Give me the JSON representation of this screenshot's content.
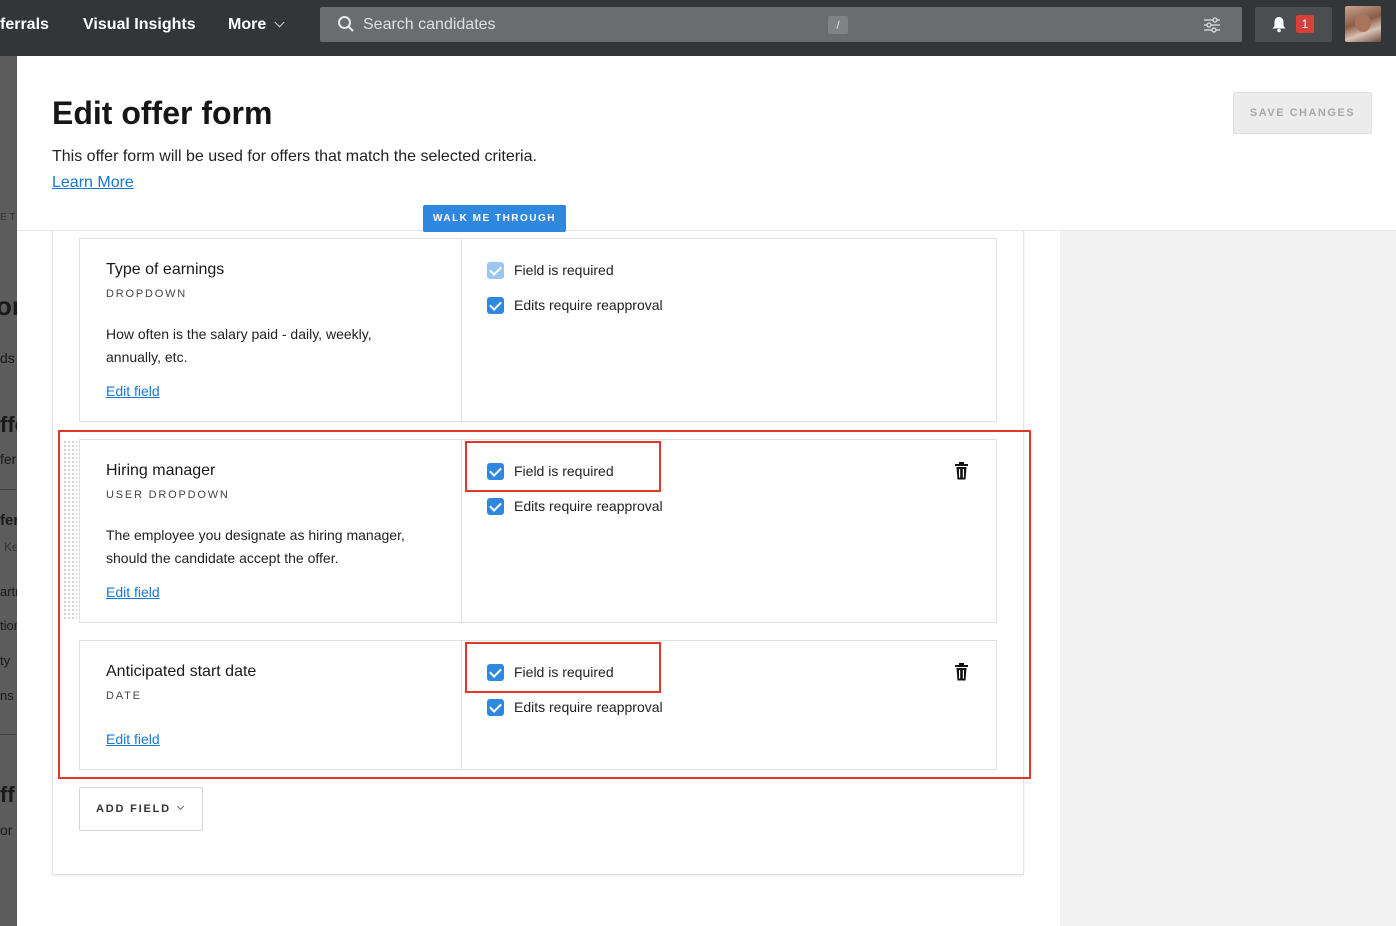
{
  "nav": {
    "items": [
      {
        "label": "ferrals"
      },
      {
        "label": "Visual Insights"
      },
      {
        "label": "More"
      }
    ],
    "search": {
      "placeholder": "Search candidates",
      "shortcut": "/"
    },
    "notifications_count": "1"
  },
  "background_page": {
    "fragments": [
      "E T",
      "or",
      "ds",
      "ffe",
      "fer",
      "fer",
      "Ke",
      "artr",
      "tion",
      "ty",
      "ns",
      "ff",
      "or"
    ]
  },
  "modal": {
    "title": "Edit offer form",
    "subtitle": "This offer form will be used for offers that match the selected criteria.",
    "learn_more": "Learn More",
    "save_button": "SAVE CHANGES",
    "walk_button": "WALK ME THROUGH",
    "add_field_button": "ADD FIELD",
    "fields": [
      {
        "name": "Type of earnings",
        "type": "DROPDOWN",
        "description": "How often is the salary paid - daily, weekly, annually, etc.",
        "edit_link": "Edit field",
        "field_required_label": "Field is required",
        "field_required_checked": true,
        "field_required_disabled": true,
        "reapproval_label": "Edits require reapproval",
        "reapproval_checked": true
      },
      {
        "name": "Hiring manager",
        "type": "USER DROPDOWN",
        "description": "The employee you designate as hiring manager, should the candidate accept the offer.",
        "edit_link": "Edit field",
        "field_required_label": "Field is required",
        "field_required_checked": true,
        "reapproval_label": "Edits require reapproval",
        "reapproval_checked": true
      },
      {
        "name": "Anticipated start date",
        "type": "DATE",
        "description": "",
        "edit_link": "Edit field",
        "field_required_label": "Field is required",
        "field_required_checked": true,
        "reapproval_label": "Edits require reapproval",
        "reapproval_checked": true
      }
    ]
  },
  "colors": {
    "nav_bg": "#333638",
    "accent_blue": "#2f88e0",
    "link_blue": "#1677d4",
    "highlight_red": "#e0392b",
    "badge_red": "#d9403a"
  }
}
